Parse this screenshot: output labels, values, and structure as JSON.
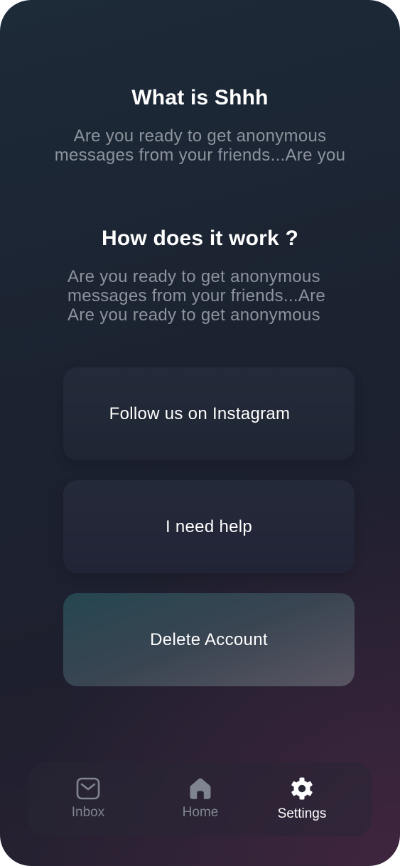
{
  "about": {
    "title": "What is Shhh",
    "body_lines": [
      "Are you ready to get anonymous",
      "messages from your friends...Are you"
    ]
  },
  "how_it_works": {
    "title": "How does it work ?",
    "body_lines": [
      "Are you ready to get anonymous",
      "messages from your friends...Are",
      "Are you ready to get anonymous"
    ]
  },
  "actions": {
    "instagram_label": "Follow us on Instagram",
    "help_label": "I need help",
    "delete_label": "Delete Account"
  },
  "tabbar": {
    "items": [
      {
        "label": "Inbox",
        "icon": "mail-icon",
        "active": false
      },
      {
        "label": "Home",
        "icon": "home-icon",
        "active": false
      },
      {
        "label": "Settings",
        "icon": "gear-icon",
        "active": true
      }
    ]
  },
  "colors": {
    "background_top": "#1d2a38",
    "background_bottom_accent": "#3b2a3e",
    "text_primary": "#ffffff",
    "text_muted": "#8d939c",
    "tab_inactive": "#7f8590",
    "delete_button_start": "#254650",
    "delete_button_end": "#5a5663"
  }
}
